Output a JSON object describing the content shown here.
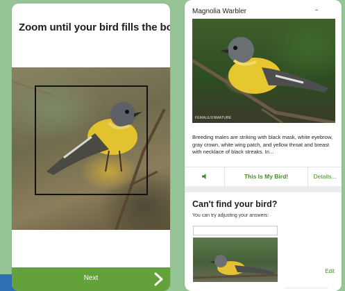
{
  "left_screen": {
    "title": "Zoom until your bird fills the box",
    "next_label": "Next",
    "accent_color": "#63a13a"
  },
  "right_screen": {
    "species_name": "Magnolia Warbler",
    "photo_credit": "FEMALE/UNMATURE",
    "description": "Breeding males are striking with black mask, white eyebrow, gray crown, white wing patch, and yellow throat and breast with necklace of black streaks. In...",
    "actions": {
      "speaker_icon": "speaker-icon",
      "my_bird_label": "This Is My Bird!",
      "details_label": "Details..."
    },
    "cant_find": {
      "title": "Can't find your bird?",
      "subtitle": "You can try adjusting your answers:",
      "edit_label": "Edit"
    }
  }
}
